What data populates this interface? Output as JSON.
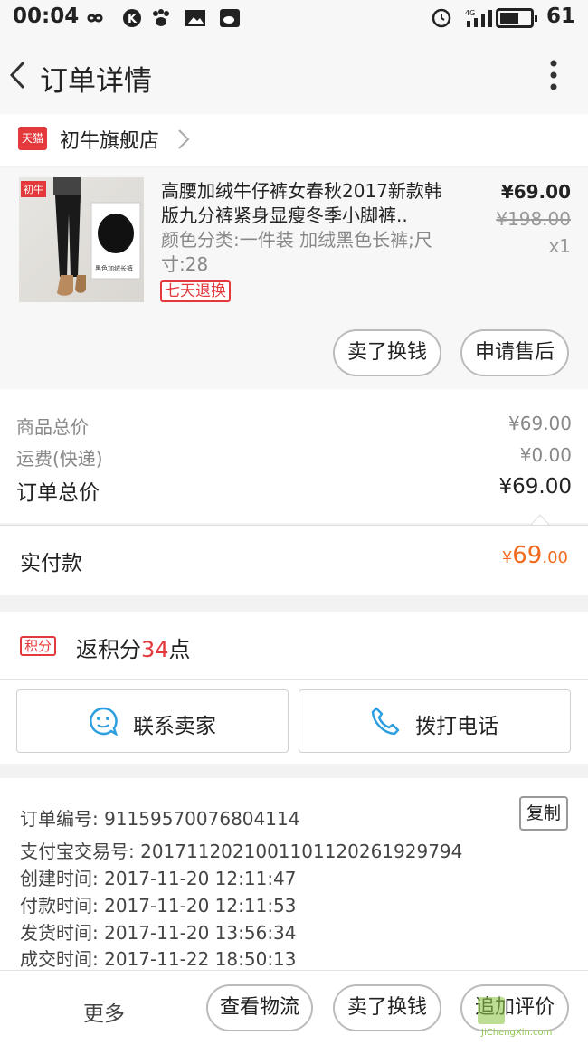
{
  "status_bar": {
    "time": "00:04",
    "network": "4G",
    "battery": "61",
    "battery_level": 0.61
  },
  "header": {
    "title": "订单详情"
  },
  "shop": {
    "badge": "天猫",
    "name": "初牛旗舰店"
  },
  "product": {
    "brand_label": "初牛",
    "thumb_caption": "黑色加绒长裤",
    "title": "高腰加绒牛仔裤女春秋2017新款韩版九分裤紧身显瘦冬季小脚裤..",
    "sku": "颜色分类:一件装 加绒黑色长裤;尺寸:28",
    "badge": "七天退换",
    "price": "¥69.00",
    "original_price": "¥198.00",
    "quantity": "x1",
    "actions": [
      "卖了换钱",
      "申请售后"
    ]
  },
  "totals": {
    "items_label": "商品总价",
    "items_value": "¥69.00",
    "shipping_label": "运费(快递)",
    "shipping_value": "¥0.00",
    "order_total_label": "订单总价",
    "order_total_value": "¥69.00"
  },
  "paid": {
    "label": "实付款",
    "currency": "¥",
    "int": "69",
    "dec": ".00"
  },
  "points": {
    "badge": "积分",
    "prefix": "返积分",
    "num": "34",
    "suffix": "点"
  },
  "contact": {
    "seller": "联系卖家",
    "phone": "拨打电话"
  },
  "order_info": {
    "order_no": "订单编号: 911595700768041​14",
    "alipay_no": "支付宝交易号: 201711202100110112026192979​4",
    "created": "创建时间: 2017-11-20 12:11:47",
    "paid_time": "付款时间: 2017-11-20 12:11:53",
    "shipped": "发货时间: 2017-11-20 13:56:34",
    "completed": "成交时间: 2017-11-22 18:50:13",
    "copy": "复制"
  },
  "bottom_bar": {
    "more": "更多",
    "logistics": "查看物流",
    "sell": "卖了换钱",
    "review": "追加评价"
  },
  "watermark": {
    "text": "JiChengXin.com"
  },
  "colors": {
    "accent_red": "#e4393c",
    "pay_orange": "#f06b1f",
    "icon_blue": "#2b9fe0"
  }
}
